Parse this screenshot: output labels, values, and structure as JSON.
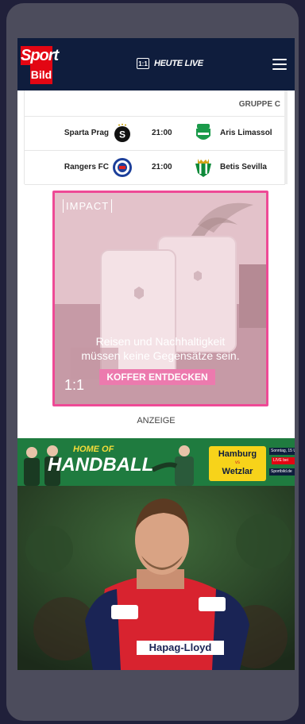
{
  "header": {
    "logo_top": "Sport",
    "logo_bottom": "Bild",
    "live_icon_text": "1:1",
    "live_label": "HEUTE LIVE"
  },
  "table": {
    "group_label": "GRUPPE C",
    "matches": [
      {
        "home": "Sparta Prag",
        "time": "21:00",
        "away": "Aris Limassol",
        "home_icon": "sparta-prag-crest-icon",
        "away_icon": "aris-limassol-crest-icon"
      },
      {
        "home": "Rangers FC",
        "time": "21:00",
        "away": "Betis Sevilla",
        "home_icon": "rangers-fc-crest-icon",
        "away_icon": "betis-sevilla-crest-icon"
      }
    ]
  },
  "ad": {
    "brand": "IMPACT",
    "headline_line1": "Reisen und Nachhaltigkeit",
    "headline_line2": "müssen keine Gegensätze sein.",
    "cta": "KOFFER ENTDECKEN",
    "ratio_mark": "1:1",
    "label": "ANZEIGE"
  },
  "banner": {
    "subtitle": "HOME OF",
    "title": "HANDBALL",
    "team_a": "Hamburg",
    "vs": "vs",
    "team_b": "Wetzlar",
    "info_date": "Sonntag, 15 Uhr",
    "info_live": "LIVE bei",
    "info_site": "Sportbild.de"
  },
  "colors": {
    "header_bg": "#0f1d3d",
    "brand_red": "#e30613",
    "ad_border": "#ee4a96",
    "banner_green": "#1f7b3f",
    "banner_yellow": "#f7d31a"
  }
}
